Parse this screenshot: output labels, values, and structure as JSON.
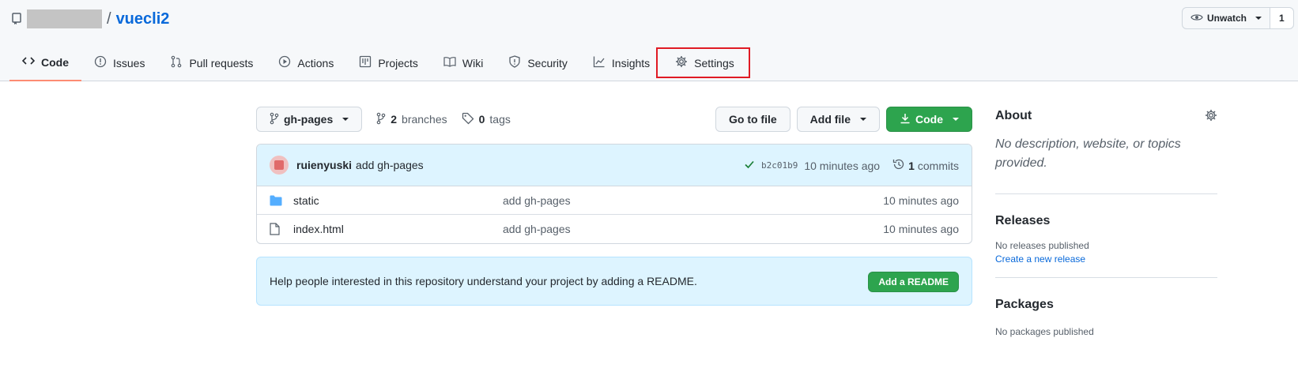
{
  "repo": {
    "name": "vuecli2",
    "slash": "/"
  },
  "watch": {
    "label": "Unwatch",
    "count": "1"
  },
  "tabs": [
    {
      "label": "Code",
      "icon": "code-icon"
    },
    {
      "label": "Issues",
      "icon": "issue-icon"
    },
    {
      "label": "Pull requests",
      "icon": "pull-request-icon"
    },
    {
      "label": "Actions",
      "icon": "play-icon"
    },
    {
      "label": "Projects",
      "icon": "project-icon"
    },
    {
      "label": "Wiki",
      "icon": "book-icon"
    },
    {
      "label": "Security",
      "icon": "shield-icon"
    },
    {
      "label": "Insights",
      "icon": "graph-icon"
    },
    {
      "label": "Settings",
      "icon": "gear-icon"
    }
  ],
  "toolbar": {
    "branch": "gh-pages",
    "branches_count": "2",
    "branches_label": "branches",
    "tags_count": "0",
    "tags_label": "tags",
    "go_to_file": "Go to file",
    "add_file": "Add file",
    "code": "Code"
  },
  "commit": {
    "author": "ruienyuski",
    "message": "add gh-pages",
    "sha": "b2c01b9",
    "time": "10 minutes ago",
    "commits_count": "1",
    "commits_label": "commits"
  },
  "files": [
    {
      "type": "folder",
      "name": "static",
      "message": "add gh-pages",
      "age": "10 minutes ago"
    },
    {
      "type": "file",
      "name": "index.html",
      "message": "add gh-pages",
      "age": "10 minutes ago"
    }
  ],
  "readme": {
    "text": "Help people interested in this repository understand your project by adding a README.",
    "button": "Add a README"
  },
  "sidebar": {
    "about_title": "About",
    "about_desc": "No description, website, or topics provided.",
    "releases_title": "Releases",
    "releases_none": "No releases published",
    "releases_link": "Create a new release",
    "packages_title": "Packages",
    "packages_none": "No packages published"
  },
  "colors": {
    "accent": "#0969da",
    "green": "#2da44e",
    "highlight_box": "#e01b24",
    "active_tab": "#fd8c73"
  }
}
